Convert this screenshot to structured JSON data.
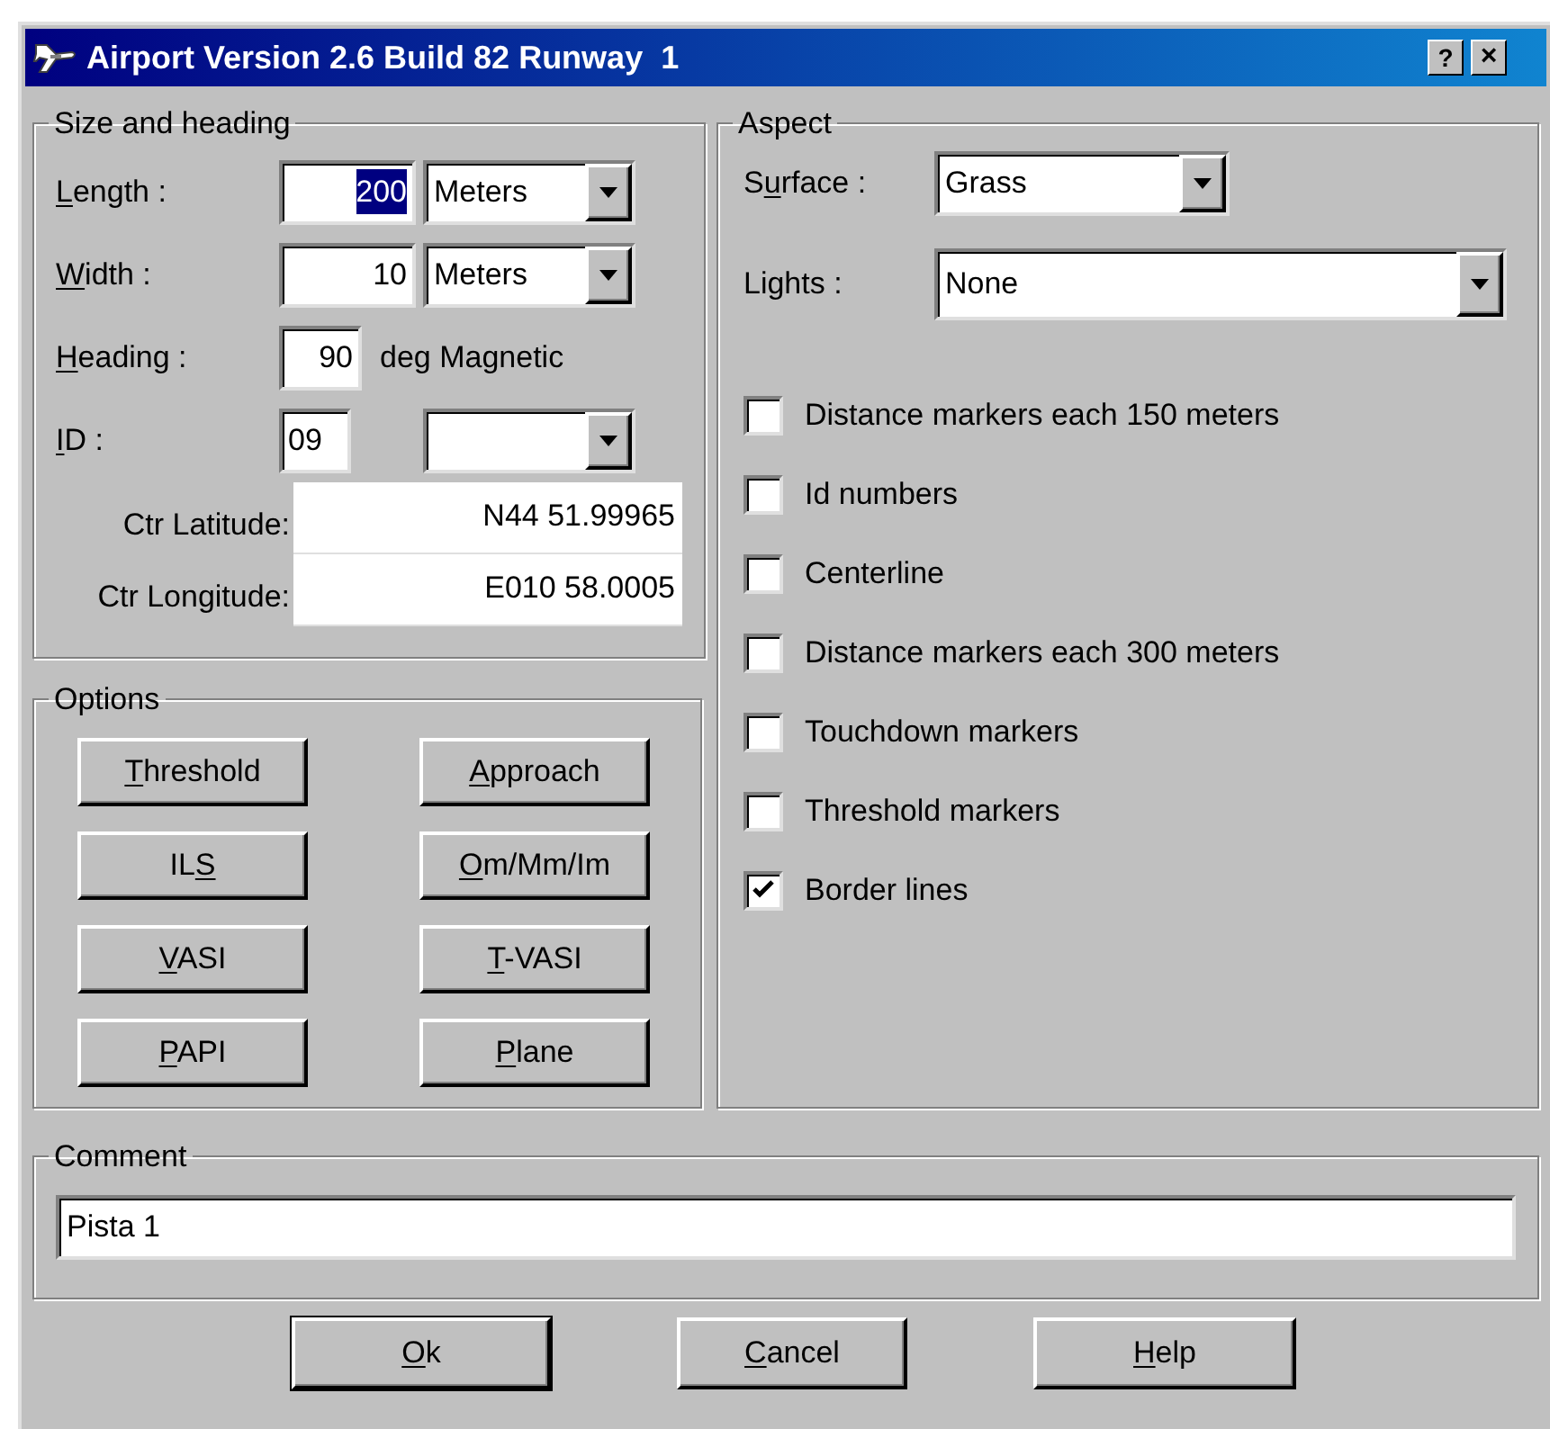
{
  "window": {
    "title": "Airport Version 2.6 Build 82 Runway  1",
    "help_button": "?",
    "close_button": "×"
  },
  "size_heading": {
    "title": "Size and heading",
    "rows": [
      {
        "kind": "measure",
        "label": {
          "key": "L",
          "post": "ength :"
        },
        "value": "200",
        "highlighted": true,
        "unit": "Meters"
      },
      {
        "kind": "measure",
        "label": {
          "key": "W",
          "post": "idth :"
        },
        "value": "10",
        "unit": "Meters"
      },
      {
        "kind": "heading",
        "label": {
          "key": "H",
          "post": "eading :"
        },
        "value": "90",
        "suffix": "deg Magnetic"
      },
      {
        "kind": "id",
        "label": {
          "key": "I",
          "post": "D :"
        },
        "value": "09"
      },
      {
        "kind": "coord",
        "label": {
          "pre": "Ctr Latitude:"
        },
        "value": "N44 51.99965"
      },
      {
        "kind": "coord",
        "label": {
          "pre": "Ctr Longitude:"
        },
        "value": "E010 58.0005"
      }
    ]
  },
  "options": {
    "title": "Options",
    "buttons": [
      {
        "key": "T",
        "post": "hreshold"
      },
      {
        "key": "A",
        "post": "pproach"
      },
      {
        "pre": "IL",
        "key": "S"
      },
      {
        "key": "O",
        "post": "m/Mm/Im"
      },
      {
        "key": "V",
        "post": "ASI"
      },
      {
        "key": "T",
        "post": "-VASI"
      },
      {
        "key": "P",
        "post": "API"
      },
      {
        "key": "P",
        "post": "lane"
      }
    ]
  },
  "aspect": {
    "title": "Aspect",
    "dropdowns": [
      {
        "label": {
          "pre": "S",
          "key": "u",
          "post": "rface :"
        },
        "value": "Grass"
      },
      {
        "label": {
          "pre": "Lights :"
        },
        "value": "None"
      }
    ],
    "checkboxes": [
      {
        "label": "Distance markers each 150 meters",
        "checked": false
      },
      {
        "label": "Id numbers",
        "checked": false
      },
      {
        "label": "Centerline",
        "checked": false
      },
      {
        "label": "Distance markers each 300 meters",
        "checked": false
      },
      {
        "label": "Touchdown markers",
        "checked": false
      },
      {
        "label": "Threshold markers",
        "checked": false
      },
      {
        "label": "Border lines",
        "checked": true
      }
    ]
  },
  "comment": {
    "title": "Comment",
    "value": "Pista 1"
  },
  "buttons": [
    {
      "label": {
        "key": "O",
        "post": "k"
      },
      "default": true
    },
    {
      "label": {
        "key": "C",
        "post": "ancel"
      },
      "default": false
    },
    {
      "label": {
        "key": "H",
        "post": "elp"
      },
      "default": false
    }
  ]
}
